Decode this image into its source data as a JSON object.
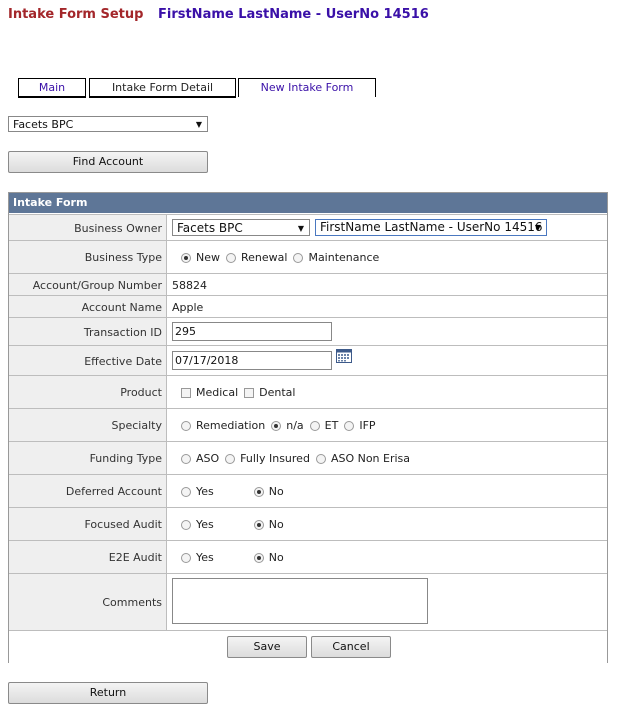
{
  "header": {
    "title": "Intake Form Setup",
    "user": "FirstName LastName - UserNo 14516"
  },
  "tabs": [
    {
      "label": "Main"
    },
    {
      "label": "Intake Form Detail"
    },
    {
      "label": "New Intake Form",
      "active": true
    }
  ],
  "top_select": {
    "value": "Facets BPC"
  },
  "find_account_label": "Find Account",
  "form": {
    "title": "Intake Form",
    "business_owner": {
      "label": "Business Owner",
      "select1": "Facets BPC",
      "select2": "FirstName LastName - UserNo 14516"
    },
    "business_type": {
      "label": "Business Type",
      "options": [
        "New",
        "Renewal",
        "Maintenance"
      ],
      "selected": "New"
    },
    "account_group": {
      "label": "Account/Group Number",
      "value": "58824"
    },
    "account_name": {
      "label": "Account Name",
      "value": "Apple"
    },
    "transaction_id": {
      "label": "Transaction ID",
      "value": "295"
    },
    "effective_date": {
      "label": "Effective Date",
      "value": "07/17/2018"
    },
    "product": {
      "label": "Product",
      "options": [
        "Medical",
        "Dental"
      ]
    },
    "specialty": {
      "label": "Specialty",
      "options": [
        "Remediation",
        "n/a",
        "ET",
        "IFP"
      ],
      "selected": "n/a"
    },
    "funding_type": {
      "label": "Funding Type",
      "options": [
        "ASO",
        "Fully Insured",
        "ASO Non Erisa"
      ]
    },
    "deferred_account": {
      "label": "Deferred Account",
      "options": [
        "Yes",
        "No"
      ],
      "selected": "No"
    },
    "focused_audit": {
      "label": "Focused Audit",
      "options": [
        "Yes",
        "No"
      ],
      "selected": "No"
    },
    "e2e_audit": {
      "label": "E2E Audit",
      "options": [
        "Yes",
        "No"
      ],
      "selected": "No"
    },
    "comments": {
      "label": "Comments",
      "value": ""
    },
    "save_label": "Save",
    "cancel_label": "Cancel"
  },
  "return_label": "Return",
  "colors": {
    "title_red": "#a3262a",
    "user_purple": "#3a10a8",
    "form_header": "#5e7697",
    "label_bg": "#efefef"
  }
}
